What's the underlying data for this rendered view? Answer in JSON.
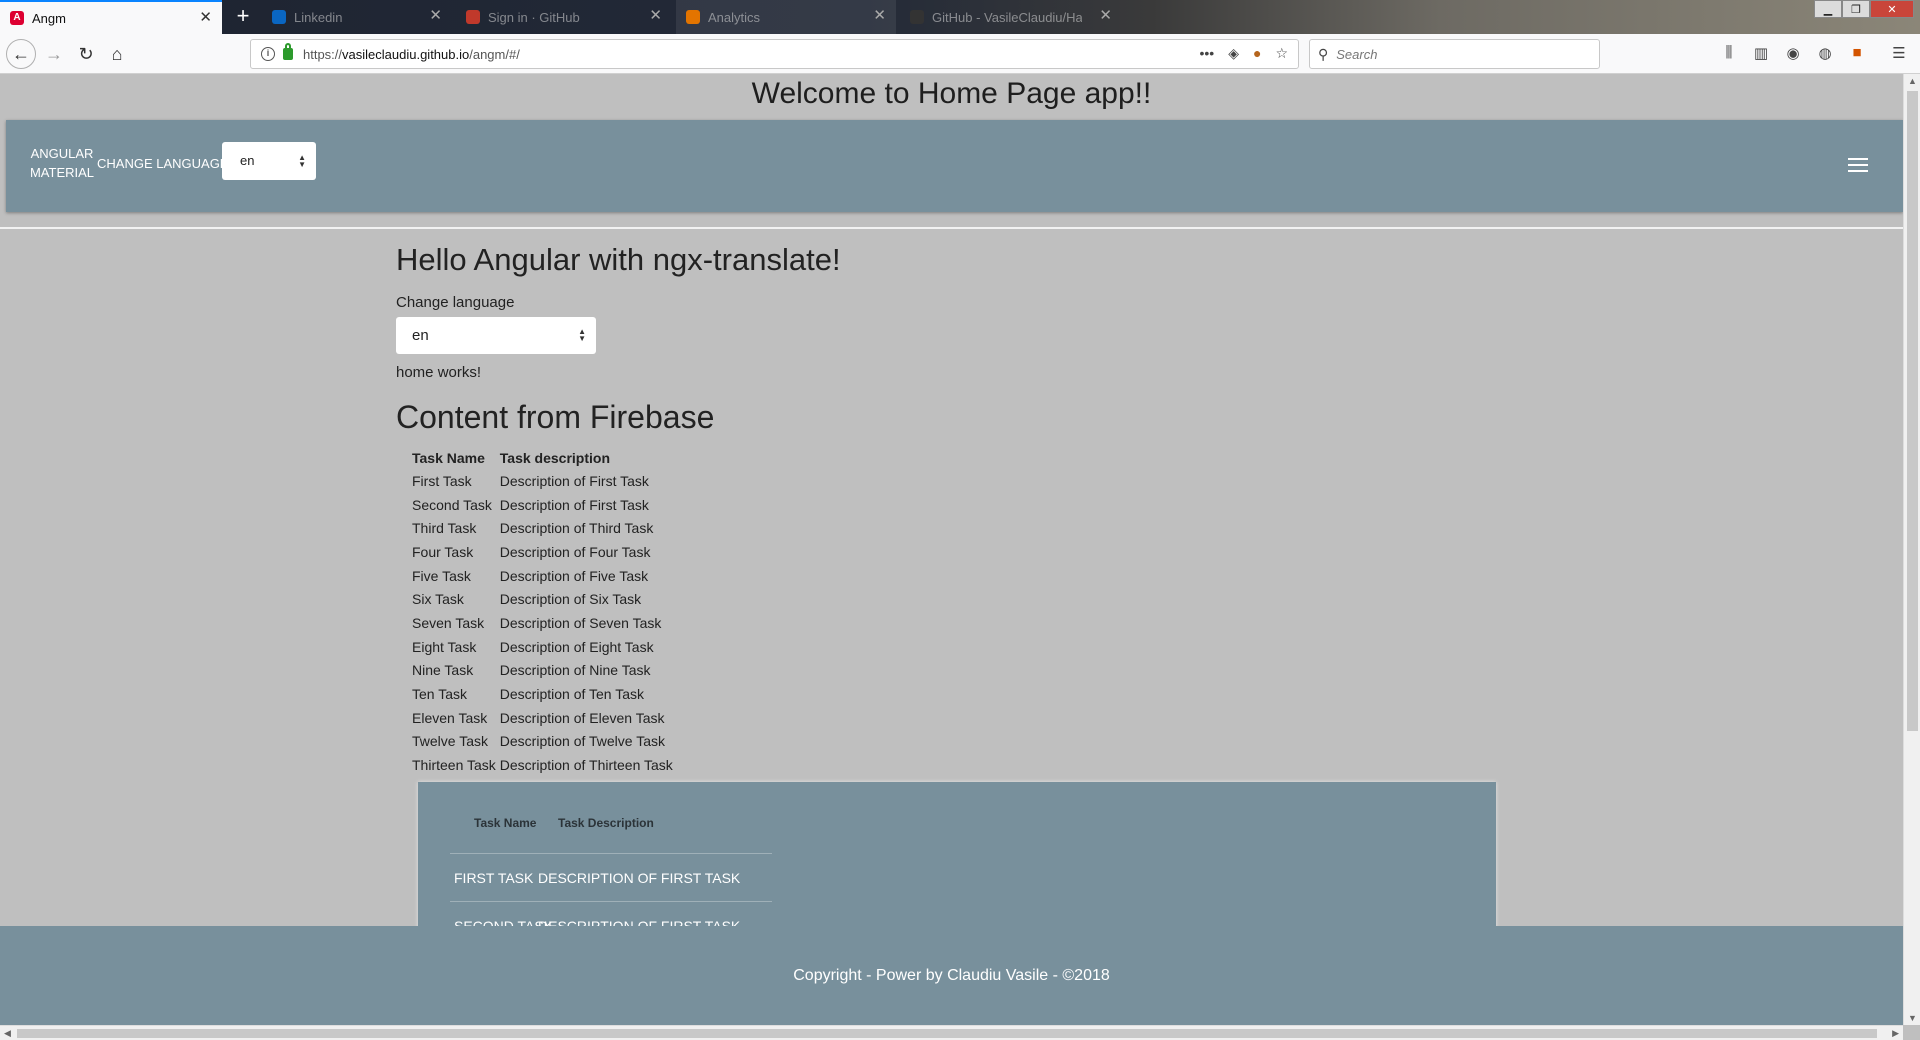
{
  "browser": {
    "tabs": [
      {
        "label": "Angm",
        "active": true
      },
      {
        "label": "Linkedin",
        "active": false
      },
      {
        "label": "Sign in · GitHub",
        "active": false
      },
      {
        "label": "Analytics",
        "active": false
      },
      {
        "label": "GitHub - VasileClaudiu/Hai·Ci",
        "active": false
      }
    ],
    "url_prefix": "https://",
    "url_host": "vasileclaudiu.github.io",
    "url_path": "/angm/#/",
    "search_placeholder": "Search",
    "page_actions_icon": "•••"
  },
  "app": {
    "title": "Welcome to Home Page app!!",
    "toolbar": {
      "brand_line1": "ANGULAR",
      "brand_line2": "MATERIAL",
      "change_language": "CHANGE LANGUAGE",
      "language_value": "en"
    },
    "hello": "Hello Angular with ngx-translate!",
    "change_language_label": "Change language",
    "language_select_value": "en",
    "home_works": "home works!",
    "firebase_title": "Content from Firebase",
    "simple_table": {
      "headers": [
        "Task Name",
        "Task description"
      ],
      "rows": [
        [
          "First Task",
          "Description of First Task"
        ],
        [
          "Second Task",
          "Description of First Task"
        ],
        [
          "Third Task",
          "Description of Third Task"
        ],
        [
          "Four Task",
          "Description of Four Task"
        ],
        [
          "Five Task",
          "Description of Five Task"
        ],
        [
          "Six Task",
          "Description of Six Task"
        ],
        [
          "Seven Task",
          "Description of Seven Task"
        ],
        [
          "Eight Task",
          "Description of Eight Task"
        ],
        [
          "Nine Task",
          "Description of Nine Task"
        ],
        [
          "Ten Task",
          "Description of Ten Task"
        ],
        [
          "Eleven Task",
          "Description of Eleven Task"
        ],
        [
          "Twelve Task",
          "Description of Twelve Task"
        ],
        [
          "Thirteen Task",
          "Description of Thirteen Task"
        ]
      ]
    },
    "mat_table": {
      "headers": [
        "Task Name",
        "Task Description"
      ],
      "rows": [
        [
          "FIRST TASK",
          "DESCRIPTION OF FIRST TASK"
        ],
        [
          "SECOND TASK",
          "DESCRIPTION OF FIRST TASK"
        ]
      ]
    },
    "footer": "Copyright - Power by Claudiu Vasile - ©2018"
  },
  "colors": {
    "toolbar": "#78909c",
    "page_bg": "#bfbfbf",
    "angular_red": "#dd0031"
  }
}
